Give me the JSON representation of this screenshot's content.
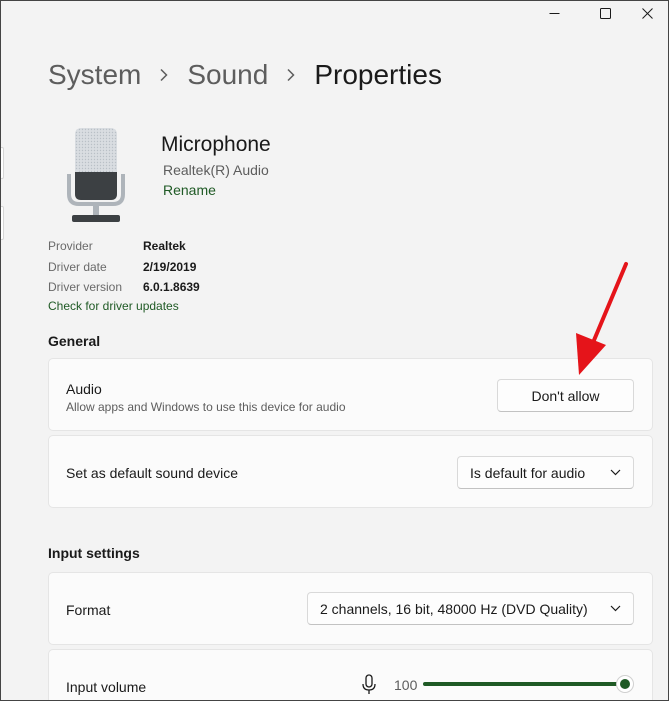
{
  "window": {
    "controls": [
      "minimize-icon",
      "maximize-icon",
      "close-icon"
    ]
  },
  "breadcrumb": {
    "items": [
      "System",
      "Sound"
    ],
    "current": "Properties",
    "separator_icon": "chevron-right-icon"
  },
  "device": {
    "icon": "microphone-device-icon",
    "name": "Microphone",
    "subtitle": "Realtek(R) Audio",
    "rename_label": "Rename"
  },
  "driver_info": {
    "rows": [
      {
        "key": "Provider",
        "value": "Realtek"
      },
      {
        "key": "Driver date",
        "value": "2/19/2019"
      },
      {
        "key": "Driver version",
        "value": "6.0.1.8639"
      }
    ],
    "update_link": "Check for driver updates"
  },
  "general": {
    "title": "General",
    "audio": {
      "title": "Audio",
      "description": "Allow apps and Windows to use this device for audio",
      "button_label": "Don't allow"
    },
    "default_device": {
      "title": "Set as default sound device",
      "selected": "Is default for audio"
    }
  },
  "input_settings": {
    "title": "Input settings",
    "format": {
      "title": "Format",
      "selected": "2 channels, 16 bit, 48000 Hz (DVD Quality)"
    },
    "input_volume": {
      "title": "Input volume",
      "icon": "microphone-icon",
      "value": "100",
      "level_percent": 100
    }
  },
  "annotation": {
    "arrow_color": "#e5141a"
  },
  "colors": {
    "accent": "#1f5a25",
    "background": "#f3f3f3",
    "card": "#fbfbfb"
  }
}
